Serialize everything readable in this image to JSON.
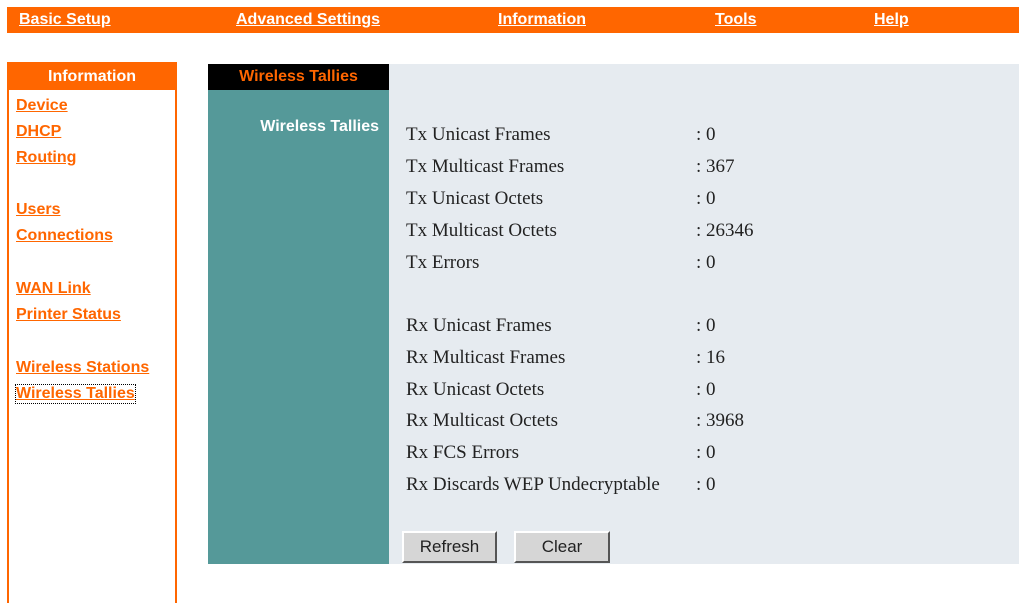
{
  "topnav": {
    "basic_setup": "Basic Setup",
    "advanced_settings": "Advanced Settings",
    "information": "Information",
    "tools": "Tools",
    "help": "Help"
  },
  "sidebar": {
    "header": "Information",
    "items": [
      {
        "label": "Device"
      },
      {
        "label": "DHCP"
      },
      {
        "label": "Routing"
      },
      {
        "label": "Users"
      },
      {
        "label": "Connections"
      },
      {
        "label": "WAN Link"
      },
      {
        "label": "Printer Status"
      },
      {
        "label": "Wireless Stations"
      },
      {
        "label": "Wireless Tallies"
      }
    ]
  },
  "content": {
    "tab": "Wireless Tallies",
    "section_label": "Wireless Tallies",
    "tx_rows": [
      {
        "label": "Tx Unicast Frames",
        "value": ": 0"
      },
      {
        "label": "Tx Multicast Frames",
        "value": ": 367"
      },
      {
        "label": "Tx Unicast Octets",
        "value": ": 0"
      },
      {
        "label": "Tx Multicast Octets",
        "value": ": 26346"
      },
      {
        "label": "Tx Errors",
        "value": ": 0"
      }
    ],
    "rx_rows": [
      {
        "label": "Rx Unicast Frames",
        "value": ": 0"
      },
      {
        "label": "Rx Multicast Frames",
        "value": ": 16"
      },
      {
        "label": "Rx Unicast Octets",
        "value": ": 0"
      },
      {
        "label": "Rx Multicast Octets",
        "value": ": 3968"
      },
      {
        "label": "Rx FCS Errors",
        "value": ": 0"
      },
      {
        "label": "Rx Discards WEP Undecryptable",
        "value": ": 0"
      }
    ],
    "buttons": {
      "refresh": "Refresh",
      "clear": "Clear"
    }
  },
  "colors": {
    "accent": "#ff6600",
    "teal": "#559999",
    "panel": "#e6ebf0"
  }
}
